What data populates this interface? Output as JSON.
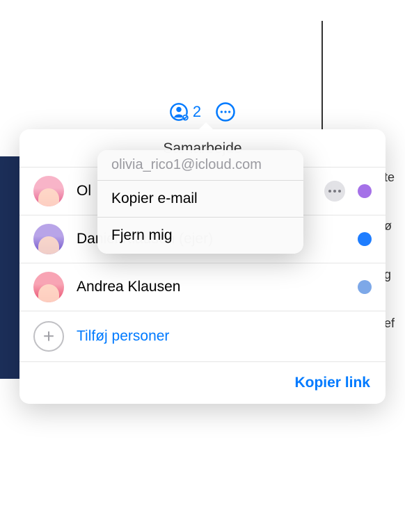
{
  "toolbar": {
    "participant_count": "2"
  },
  "popover": {
    "title": "Samarbejde",
    "participants": [
      {
        "name": "Olivia Rico (mig)",
        "name_visible": "Ol",
        "status_color": "#a571e8",
        "has_more": true
      },
      {
        "name": "Daniel Klausen (ejer)",
        "status_color": "#1e7dff",
        "has_more": false
      },
      {
        "name": "Andrea Klausen",
        "status_color": "#7da8e8",
        "has_more": false
      }
    ],
    "add_label": "Tilføj personer",
    "copy_link_label": "Kopier link"
  },
  "context_menu": {
    "email": "olivia_rico1@icloud.com",
    "copy_email": "Kopier e-mail",
    "remove_me": "Fjern mig"
  }
}
